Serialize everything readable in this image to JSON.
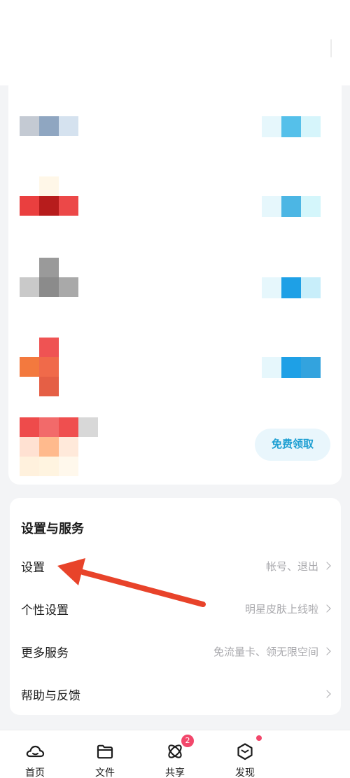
{
  "benefits": {
    "claim_label": "免费领取"
  },
  "settings": {
    "title": "设置与服务",
    "items": [
      {
        "label": "设置",
        "hint": "帐号、退出"
      },
      {
        "label": "个性设置",
        "hint": "明星皮肤上线啦"
      },
      {
        "label": "更多服务",
        "hint": "免流量卡、领无限空间"
      },
      {
        "label": "帮助与反馈",
        "hint": ""
      }
    ]
  },
  "tabs": [
    {
      "label": "首页",
      "icon": "cloud-home-icon"
    },
    {
      "label": "文件",
      "icon": "folder-icon"
    },
    {
      "label": "共享",
      "icon": "share-atom-icon",
      "badge": "2"
    },
    {
      "label": "发现",
      "icon": "discover-box-icon",
      "dot": true
    }
  ],
  "colors": {
    "accent": "#1e9fd2",
    "badge": "#f2476b",
    "annotation_arrow": "#e8432a"
  }
}
